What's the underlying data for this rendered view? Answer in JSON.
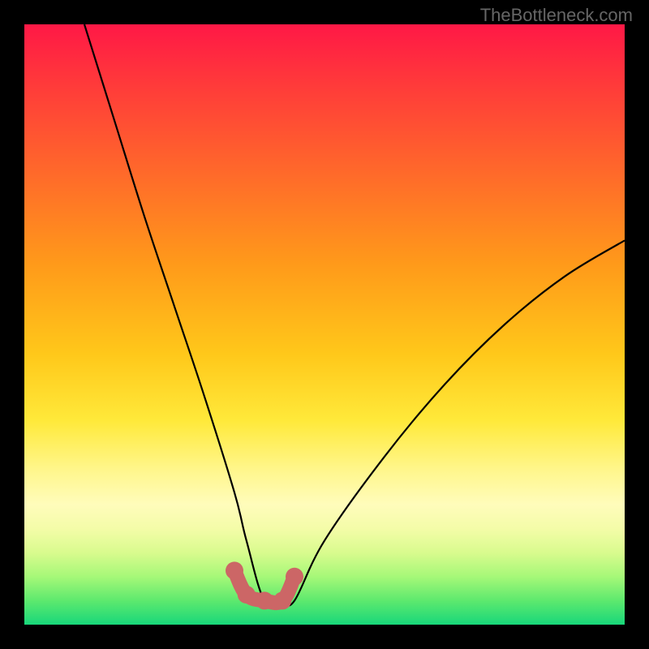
{
  "watermark": "TheBottleneck.com",
  "chart_data": {
    "type": "line",
    "title": "",
    "xlabel": "",
    "ylabel": "",
    "xlim": [
      0,
      100
    ],
    "ylim": [
      0,
      100
    ],
    "background_gradient": {
      "top": "#ff1846",
      "middle": "#ffe93a",
      "bottom": "#18d77a",
      "meaning": "red=high, green=low (bottleneck curve)"
    },
    "series": [
      {
        "name": "bottleneck-curve",
        "color": "#000000",
        "x": [
          10,
          15,
          20,
          25,
          30,
          35,
          37,
          40,
          43,
          45,
          50,
          60,
          70,
          80,
          90,
          100
        ],
        "values": [
          100,
          84,
          68,
          53,
          38,
          22,
          14,
          4,
          4,
          4,
          14,
          28,
          40,
          50,
          58,
          64
        ]
      },
      {
        "name": "bottleneck-curve-optimal-region",
        "color": "#cc6666",
        "x": [
          35,
          37,
          40,
          43,
          45
        ],
        "values": [
          9,
          5,
          4,
          4,
          8
        ]
      }
    ]
  }
}
